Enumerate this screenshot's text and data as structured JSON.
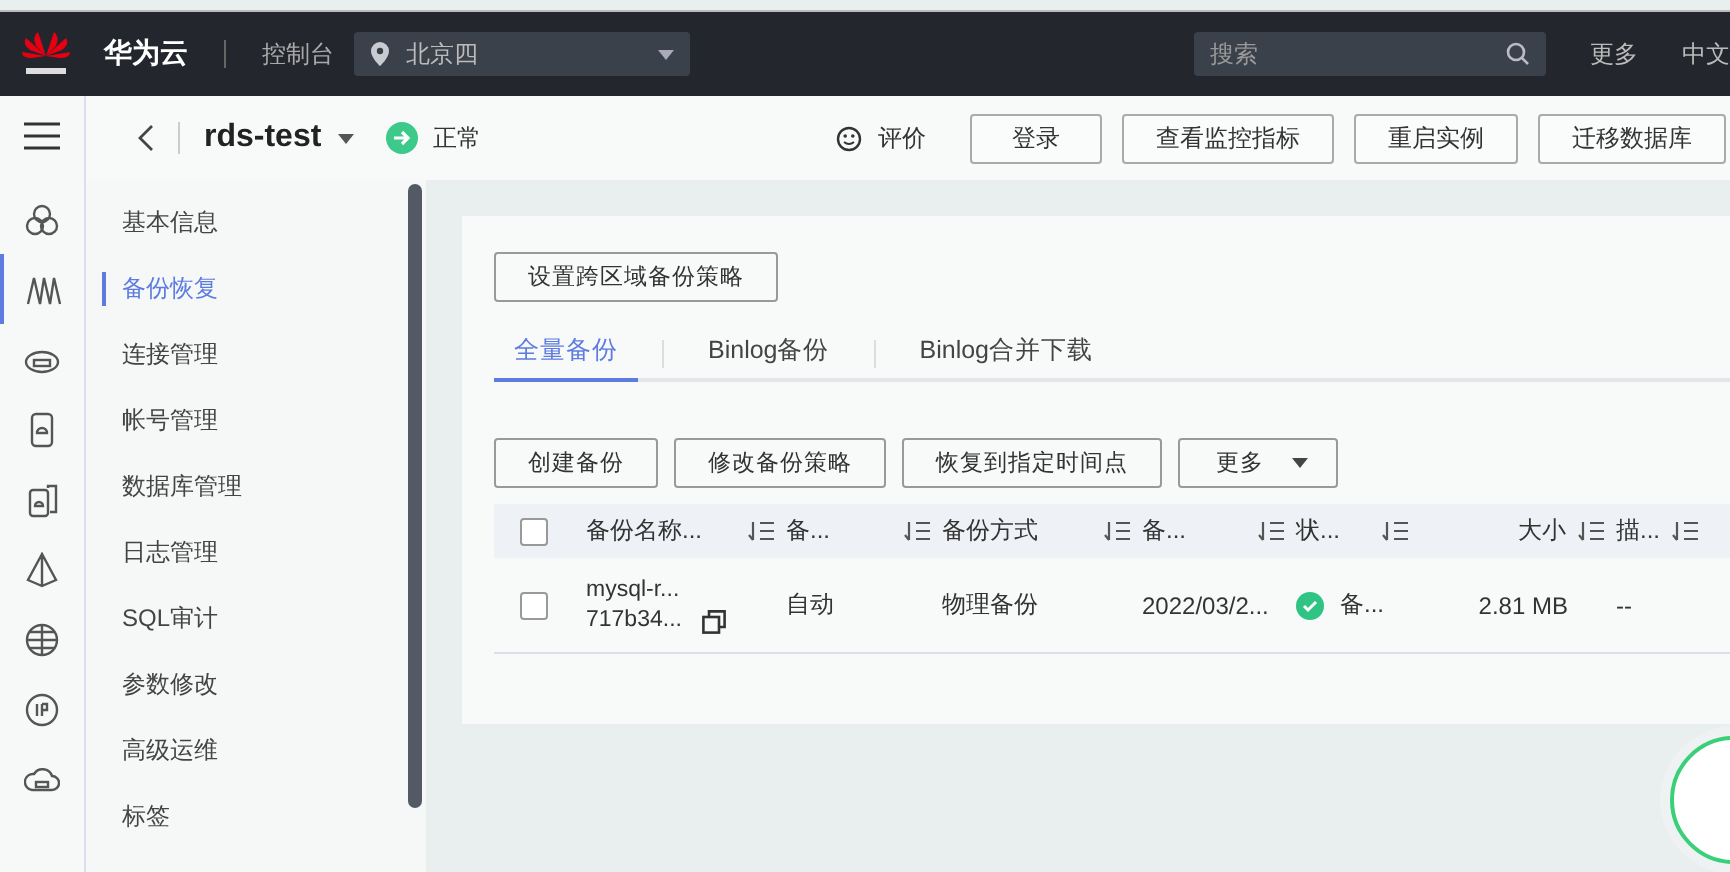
{
  "topbar": {
    "brand": "华为云",
    "console": "控制台",
    "region": "北京四",
    "search": {
      "placeholder": "搜索"
    },
    "links": [
      "更多",
      "中文"
    ]
  },
  "rail": [
    {
      "kind": "clover",
      "selected": false
    },
    {
      "kind": "waves",
      "selected": true
    },
    {
      "kind": "cloud-disk",
      "selected": false
    },
    {
      "kind": "card",
      "selected": false
    },
    {
      "kind": "cards",
      "selected": false
    },
    {
      "kind": "triangle",
      "selected": false
    },
    {
      "kind": "globe",
      "selected": false
    },
    {
      "kind": "ip",
      "selected": false
    },
    {
      "kind": "cloud",
      "selected": false
    }
  ],
  "header": {
    "instance": "rds-test",
    "status": "正常",
    "rate": "评价",
    "buttons": [
      "登录",
      "查看监控指标",
      "重启实例",
      "迁移数据库"
    ]
  },
  "sidebar": {
    "items": [
      {
        "label": "基本信息",
        "selected": false
      },
      {
        "label": "备份恢复",
        "selected": true
      },
      {
        "label": "连接管理",
        "selected": false
      },
      {
        "label": "帐号管理",
        "selected": false
      },
      {
        "label": "数据库管理",
        "selected": false
      },
      {
        "label": "日志管理",
        "selected": false
      },
      {
        "label": "SQL审计",
        "selected": false
      },
      {
        "label": "参数修改",
        "selected": false
      },
      {
        "label": "高级运维",
        "selected": false
      },
      {
        "label": "标签",
        "selected": false
      }
    ]
  },
  "content": {
    "cross_region_button": "设置跨区域备份策略",
    "tabs": [
      {
        "label": "全量备份",
        "selected": true
      },
      {
        "label": "Binlog备份",
        "selected": false
      },
      {
        "label": "Binlog合并下载",
        "selected": false
      }
    ],
    "actions": [
      "创建备份",
      "修改备份策略",
      "恢复到指定时间点"
    ],
    "more": "更多",
    "table": {
      "all_selected": false,
      "columns": [
        {
          "label": "备份名称..."
        },
        {
          "label": "备..."
        },
        {
          "label": "备份方式"
        },
        {
          "label": "备..."
        },
        {
          "label": "状..."
        },
        {
          "label": "大小"
        },
        {
          "label": "描..."
        }
      ],
      "rows": [
        {
          "selected": false,
          "name": [
            "mysql-r...",
            "717b34..."
          ],
          "type": "自动",
          "method": "物理备份",
          "time": "2022/03/2...",
          "status": {
            "kind": "success",
            "label": "备..."
          },
          "size": "2.81 MB",
          "desc": "--"
        }
      ]
    }
  }
}
